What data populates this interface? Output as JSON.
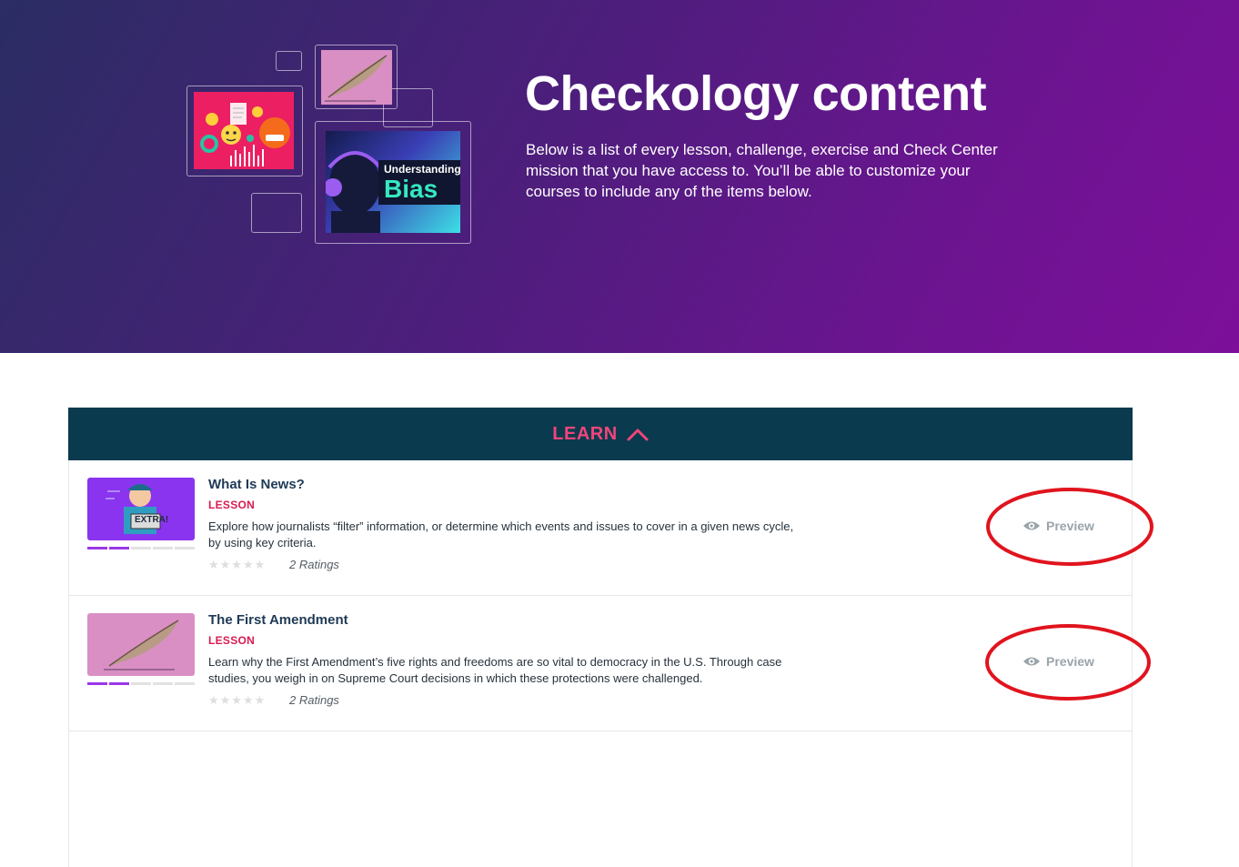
{
  "hero": {
    "title": "Checkology content",
    "description": "Below is a list of every lesson, challenge, exercise and Check Center mission that you have access to. You’ll be able to customize your courses to include any of the items below.",
    "bias_tile": {
      "small": "Understanding",
      "big": "Bias"
    }
  },
  "learn": {
    "label": "LEARN",
    "expanded": true,
    "lessons": [
      {
        "title": "What Is News?",
        "type": "LESSON",
        "description": "Explore how journalists “filter” information, or determine which events and issues to cover in a given news cycle, by using key criteria.",
        "stars": "★★★★★",
        "ratings": "2 Ratings",
        "preview_label": "Preview",
        "progress_segments": 5,
        "progress_complete": 2,
        "thumbnail_text": "EXTRA!"
      },
      {
        "title": "The First Amendment",
        "type": "LESSON",
        "description": "Learn why the First Amendment’s five rights and freedoms are so vital to democracy in the U.S. Through case studies, you weigh in on Supreme Court decisions in which these protections were challenged.",
        "stars": "★★★★★",
        "ratings": "2 Ratings",
        "preview_label": "Preview",
        "progress_segments": 5,
        "progress_complete": 2
      }
    ]
  },
  "colors": {
    "learn_header_bg": "#0a3a4e",
    "learn_label": "#f2457a",
    "lesson_type": "#d81b52",
    "annotation_circle": "#e0141e"
  }
}
